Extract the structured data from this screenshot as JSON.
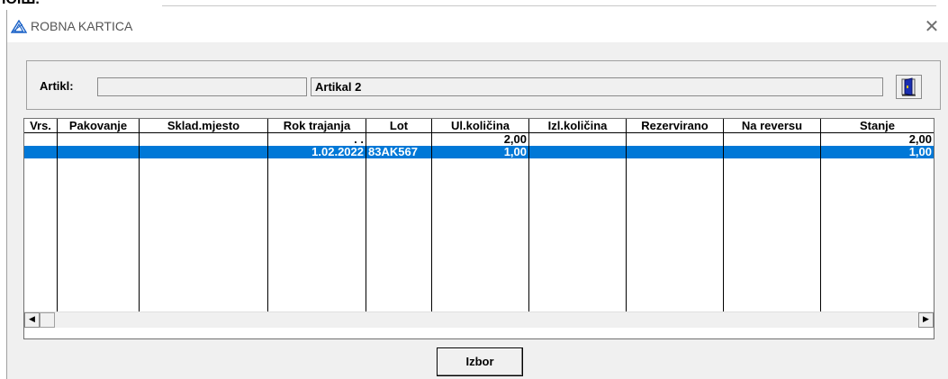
{
  "background_text": "ІОІШ.",
  "window": {
    "title": "ROBNA KARTICA"
  },
  "article": {
    "label": "Artikl:",
    "code": "",
    "name": "Artikal 2"
  },
  "grid": {
    "columns": [
      "Vrs.",
      "Pakovanje",
      "Sklad.mjesto",
      "Rok trajanja",
      "Lot",
      "Ul.količina",
      "Izl.količina",
      "Rezervirano",
      "Na reversu",
      "Stanje"
    ],
    "rows": [
      [
        "",
        "",
        "",
        ". .",
        "",
        "2,00",
        "",
        "",
        "",
        "2,00"
      ],
      [
        "",
        "",
        "",
        "1.02.2022",
        "83AK567",
        "1,00",
        "",
        "",
        "",
        "1,00"
      ]
    ],
    "selected_row": 1
  },
  "buttons": {
    "izbor": "Izbor"
  },
  "colors": {
    "selection": "#0078d7",
    "door_icon": "#1a2fb0",
    "accent": "#1e64c8"
  },
  "icons": {
    "app": "triangle-logo-icon",
    "close": "close-icon",
    "door": "exit-door-icon",
    "scroll_left": "arrow-left-icon",
    "scroll_right": "arrow-right-icon"
  }
}
